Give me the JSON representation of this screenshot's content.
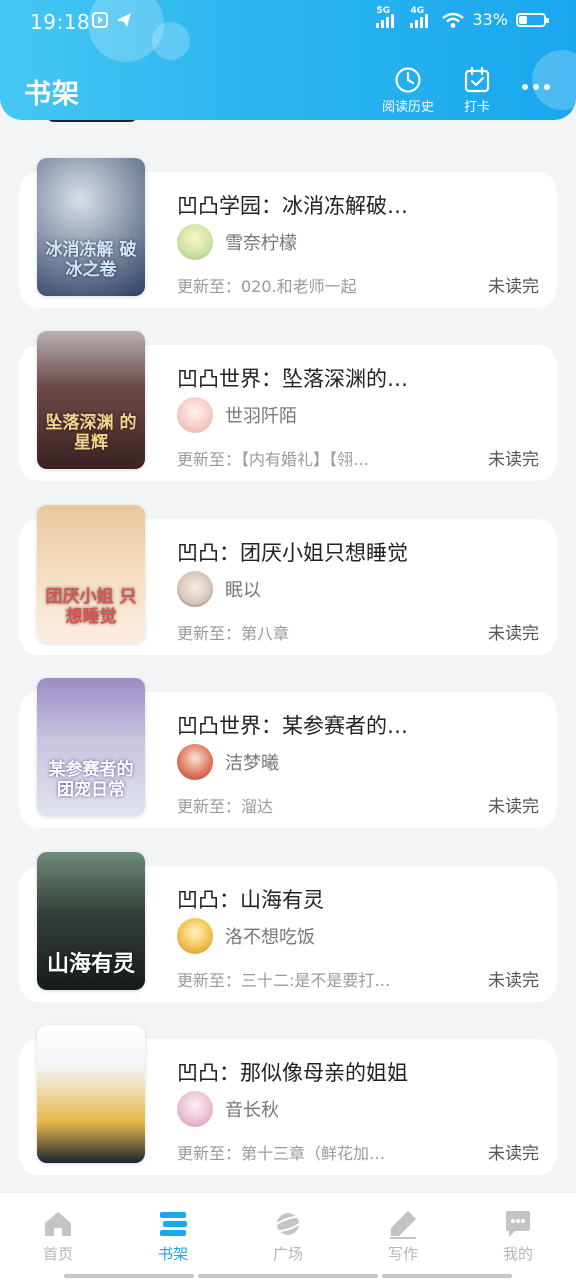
{
  "status_bar": {
    "time": "19:18",
    "net1": "5G",
    "net2": "4G",
    "battery": "33%",
    "battery_level": 0.33
  },
  "header": {
    "title": "书架",
    "history_label": "阅读历史",
    "checkin_label": "打卡",
    "more_icon": "more-dots-icon",
    "gradient_start": "#45c7f3",
    "gradient_end": "#1aa7ef"
  },
  "books": [
    {
      "title": "凹凸学园：冰消冻解破…",
      "author": "雪奈柠檬",
      "update": "更新至：020.和老师一起",
      "status": "未读完",
      "cover_text": "冰消冻解 破冰之卷"
    },
    {
      "title": "凹凸世界：坠落深渊的…",
      "author": "世羽阡陌",
      "update": "更新至：【内有婚礼】【翎…",
      "status": "未读完",
      "cover_text": "坠落深渊 的星辉"
    },
    {
      "title": "凹凸：团厌小姐只想睡觉",
      "author": "眠以",
      "update": "更新至：第八章",
      "status": "未读完",
      "cover_text": "团厌小姐 只想睡觉"
    },
    {
      "title": "凹凸世界：某参赛者的…",
      "author": "洁梦曦",
      "update": "更新至：溜达",
      "status": "未读完",
      "cover_text": "某参赛者的 团宠日常"
    },
    {
      "title": "凹凸：山海有灵",
      "author": "洛不想吃饭",
      "update": "更新至：三十二:是不是要打…",
      "status": "未读完",
      "cover_text": "山海有灵"
    },
    {
      "title": "凹凸：那似像母亲的姐姐",
      "author": "音长秋",
      "update": "更新至：第十三章（鲜花加…",
      "status": "未读完",
      "cover_text": ""
    }
  ],
  "bottom_nav": [
    {
      "label": "首页",
      "icon": "home-icon",
      "active": false
    },
    {
      "label": "书架",
      "icon": "bookshelf-icon",
      "active": true
    },
    {
      "label": "广场",
      "icon": "planet-icon",
      "active": false
    },
    {
      "label": "写作",
      "icon": "pen-icon",
      "active": false
    },
    {
      "label": "我的",
      "icon": "chat-bubble-icon",
      "active": false
    }
  ],
  "accent_color": "#1aa7ef"
}
